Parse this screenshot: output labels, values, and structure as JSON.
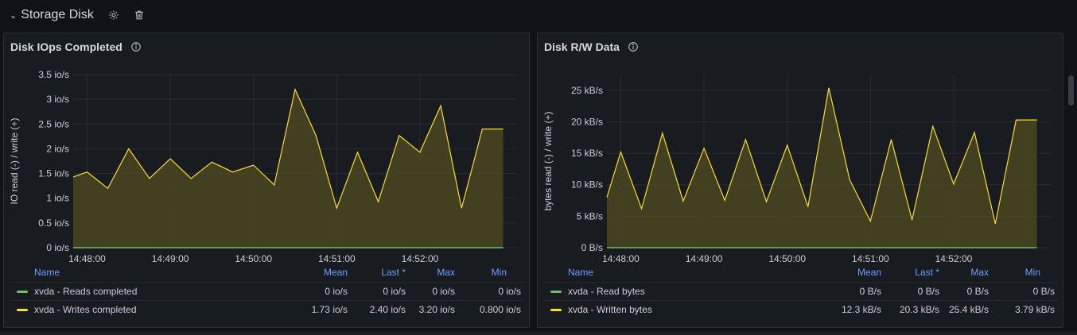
{
  "row": {
    "title": "Storage Disk"
  },
  "icons": {
    "chevron": "chevron-down-icon",
    "settings": "gear-icon",
    "delete": "trash-icon",
    "info": "info-icon"
  },
  "colors": {
    "reads": "#73bf69",
    "writes": "#fade2a",
    "legend_header": "#6e9fff",
    "fill": "#4a4621"
  },
  "panels": [
    {
      "title": "Disk IOps Completed",
      "legend": {
        "headers": [
          "Name",
          "Mean",
          "Last *",
          "Max",
          "Min"
        ],
        "rows": [
          {
            "name": "xvda - Reads completed",
            "mean": "0 io/s",
            "last": "0 io/s",
            "max": "0 io/s",
            "min": "0 io/s"
          },
          {
            "name": "xvda - Writes completed",
            "mean": "1.73 io/s",
            "last": "2.40 io/s",
            "max": "3.20 io/s",
            "min": "0.800 io/s"
          }
        ]
      }
    },
    {
      "title": "Disk R/W Data",
      "legend": {
        "headers": [
          "Name",
          "Mean",
          "Last *",
          "Max",
          "Min"
        ],
        "rows": [
          {
            "name": "xvda - Read bytes",
            "mean": "0 B/s",
            "last": "0 B/s",
            "max": "0 B/s",
            "min": "0 B/s"
          },
          {
            "name": "xvda - Written bytes",
            "mean": "12.3 kB/s",
            "last": "20.3 kB/s",
            "max": "25.4 kB/s",
            "min": "3.79 kB/s"
          }
        ]
      }
    }
  ],
  "chart_data": [
    {
      "type": "area",
      "title": "Disk IOps Completed",
      "ylabel": "IO read (-) / write (+)",
      "xlabel": "",
      "ylim": [
        0,
        3.5
      ],
      "yticks": [
        "0 io/s",
        "0.5 io/s",
        "1 io/s",
        "1.5 io/s",
        "2 io/s",
        "2.5 io/s",
        "3 io/s",
        "3.5 io/s"
      ],
      "ytick_values": [
        0,
        0.5,
        1,
        1.5,
        2,
        2.5,
        3,
        3.5
      ],
      "xlim": [
        "14:47:50",
        "14:53:10"
      ],
      "xticks": [
        "14:48:00",
        "14:49:00",
        "14:50:00",
        "14:51:00",
        "14:52:00"
      ],
      "grid": true,
      "series": [
        {
          "name": "xvda - Writes completed",
          "x": [
            "14:47:50",
            "14:48:00",
            "14:48:15",
            "14:48:30",
            "14:48:45",
            "14:49:00",
            "14:49:15",
            "14:49:30",
            "14:49:45",
            "14:50:00",
            "14:50:15",
            "14:50:30",
            "14:50:45",
            "14:51:00",
            "14:51:15",
            "14:51:30",
            "14:51:45",
            "14:52:00",
            "14:52:15",
            "14:52:30",
            "14:52:45",
            "14:53:00"
          ],
          "values": [
            1.43,
            1.53,
            1.2,
            2.0,
            1.4,
            1.8,
            1.4,
            1.73,
            1.53,
            1.67,
            1.27,
            3.2,
            2.27,
            0.8,
            1.93,
            0.93,
            2.27,
            1.93,
            2.87,
            0.8,
            2.4,
            2.4
          ]
        },
        {
          "name": "xvda - Reads completed",
          "x": [
            "14:47:50",
            "14:53:00"
          ],
          "values": [
            0,
            0
          ]
        }
      ]
    },
    {
      "type": "area",
      "title": "Disk R/W Data",
      "ylabel": "bytes read (-) / write (+)",
      "xlabel": "",
      "ylim": [
        0,
        27.5
      ],
      "yticks": [
        "0 B/s",
        "5 kB/s",
        "10 kB/s",
        "15 kB/s",
        "20 kB/s",
        "25 kB/s"
      ],
      "ytick_values": [
        0,
        5,
        10,
        15,
        20,
        25
      ],
      "xlim": [
        "14:47:50",
        "14:53:10"
      ],
      "xticks": [
        "14:48:00",
        "14:49:00",
        "14:50:00",
        "14:51:00",
        "14:52:00"
      ],
      "grid": true,
      "series": [
        {
          "name": "xvda - Written bytes",
          "x": [
            "14:47:50",
            "14:48:00",
            "14:48:15",
            "14:48:30",
            "14:48:45",
            "14:49:00",
            "14:49:15",
            "14:49:30",
            "14:49:45",
            "14:50:00",
            "14:50:15",
            "14:50:30",
            "14:50:45",
            "14:51:00",
            "14:51:15",
            "14:51:30",
            "14:51:45",
            "14:52:00",
            "14:52:15",
            "14:52:30",
            "14:52:45",
            "14:53:00"
          ],
          "values": [
            8.0,
            15.2,
            6.2,
            18.2,
            7.4,
            15.8,
            7.5,
            17.2,
            7.3,
            16.3,
            6.5,
            25.4,
            10.8,
            4.2,
            17.2,
            4.4,
            19.3,
            10.1,
            18.3,
            3.8,
            20.3,
            20.3
          ]
        },
        {
          "name": "xvda - Read bytes",
          "x": [
            "14:47:50",
            "14:53:00"
          ],
          "values": [
            0,
            0
          ]
        }
      ]
    }
  ]
}
